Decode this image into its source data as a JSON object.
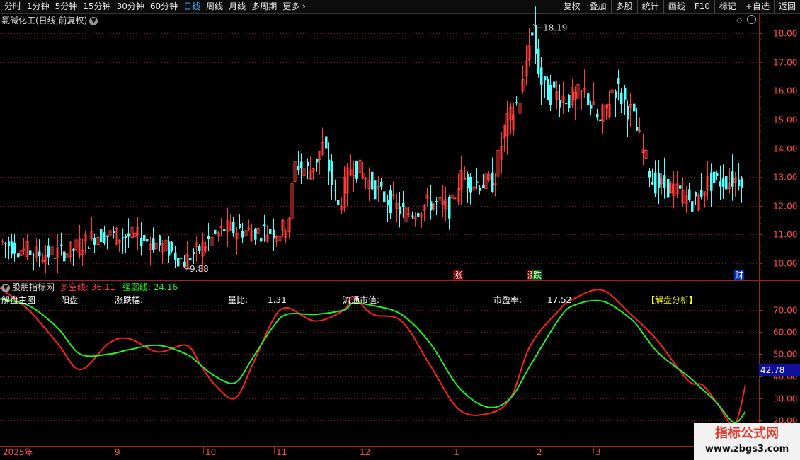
{
  "toolbar": {
    "periods": [
      "分时",
      "1分钟",
      "5分钟",
      "15分钟",
      "30分钟",
      "60分钟",
      "日线",
      "周线",
      "月线",
      "多周期",
      "更多"
    ],
    "active_period": "日线",
    "buttons": [
      "复权",
      "叠加",
      "多股",
      "统计",
      "画线",
      "F10",
      "标记",
      "+自选",
      "返回"
    ]
  },
  "stock": {
    "title": "氯碱化工(日线,前复权)"
  },
  "price_axis": {
    "ticks": [
      "18.00",
      "17.00",
      "16.00",
      "15.00",
      "14.00",
      "13.00",
      "12.00",
      "11.00",
      "10.00"
    ]
  },
  "annotations": {
    "high": "18.19",
    "low": "9.88"
  },
  "markers": {
    "zhang": "涨",
    "die": "跌",
    "cai": "财"
  },
  "indicator": {
    "name": "股朋指标网",
    "duokong_label": "多空线:",
    "duokong_value": "36.11",
    "qiangruo_label": "强弱线:",
    "qiangruo_value": "24.16",
    "row": {
      "main": "解盘主图",
      "yang": "阳盘",
      "zhangdiefu": "涨跌幅:",
      "liangbi_label": "量比:",
      "liangbi_value": "1.31",
      "shizhi": "流通市值:",
      "shiying_label": "市盈率:",
      "shiying_value": "17.52",
      "analysis": "【解盘分析】"
    },
    "axis_ticks": [
      "70.00",
      "60.00",
      "50.00",
      "40.00",
      "30.00",
      "20.00"
    ],
    "current_value": "42.78"
  },
  "date_axis": {
    "labels": [
      "2025年",
      "9",
      "10",
      "11",
      "12",
      "1",
      "2",
      "3"
    ]
  },
  "watermark": {
    "main": "指标公式网",
    "sub": "www.zbgs3.com"
  },
  "colors": {
    "up": "#ff3b3b",
    "down": "#54ffff",
    "line_red": "#ff2020",
    "line_green": "#22ee22",
    "grid": "#8a1a1a"
  },
  "chart_data": {
    "type": "line",
    "price_range": [
      9.7,
      18.6
    ],
    "indicator_range": [
      15,
      82
    ],
    "series": [
      {
        "name": "多空线",
        "x": [
          0,
          10,
          20,
          28,
          38,
          45,
          55,
          65,
          70,
          75,
          82,
          88,
          95,
          100,
          110,
          120,
          123,
          130,
          140,
          150,
          160,
          170,
          178,
          185,
          195,
          200,
          210,
          220,
          225,
          230,
          240,
          245,
          250,
          256,
          260
        ],
        "values": [
          80,
          70,
          55,
          43,
          55,
          57,
          51,
          54,
          45,
          36,
          30,
          45,
          65,
          71,
          65,
          70,
          76,
          68,
          65,
          45,
          25,
          23,
          30,
          54,
          70,
          75,
          79,
          68,
          62,
          55,
          38,
          36,
          28,
          18,
          36
        ]
      },
      {
        "name": "强弱线",
        "x": [
          0,
          10,
          20,
          28,
          38,
          45,
          55,
          65,
          70,
          75,
          82,
          88,
          95,
          100,
          110,
          120,
          123,
          130,
          140,
          150,
          160,
          170,
          178,
          185,
          195,
          200,
          210,
          220,
          225,
          230,
          240,
          245,
          250,
          256,
          260
        ],
        "values": [
          75,
          72,
          62,
          50,
          50,
          52,
          54,
          50,
          45,
          40,
          37,
          48,
          62,
          68,
          68,
          70,
          73,
          72,
          68,
          55,
          35,
          26,
          30,
          45,
          66,
          72,
          74,
          66,
          58,
          50,
          40,
          34,
          28,
          19,
          24
        ]
      }
    ]
  }
}
